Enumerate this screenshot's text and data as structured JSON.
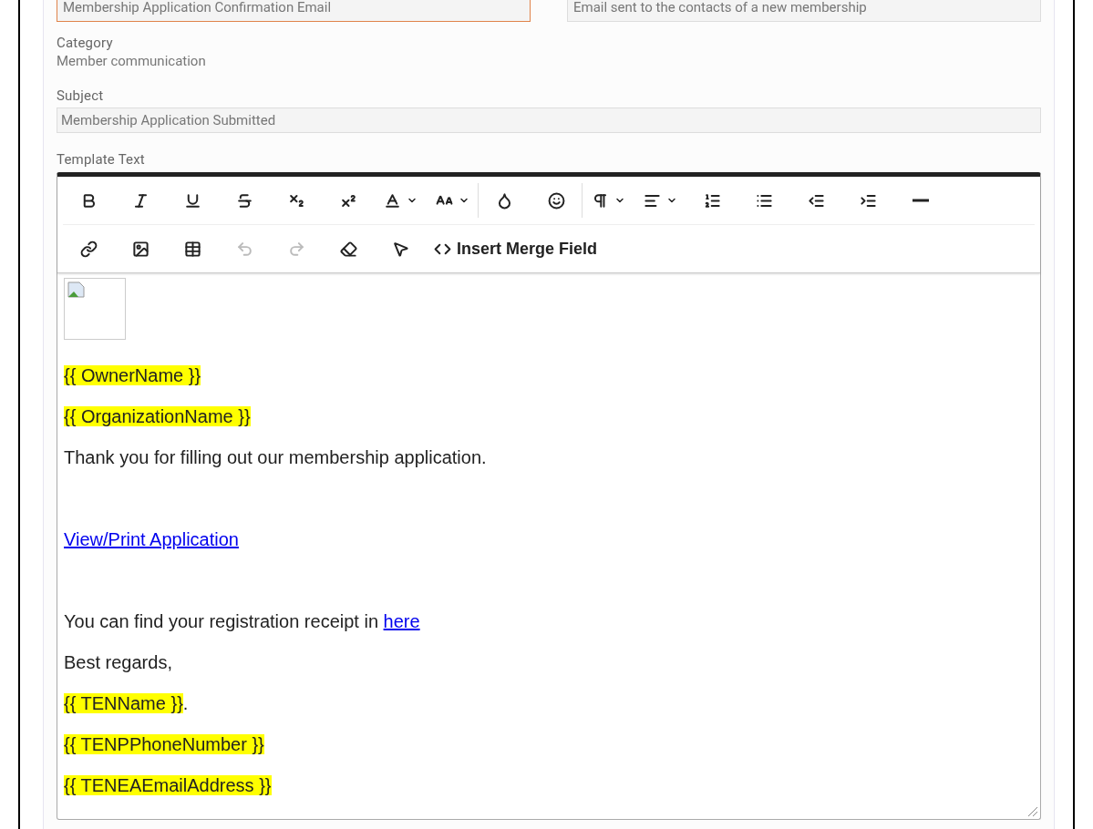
{
  "top_fields": [
    {
      "value": "Membership Application Confirmation Email",
      "focused": true
    },
    {
      "value": "Email sent to the contacts of a new membership",
      "focused": false
    }
  ],
  "category": {
    "label": "Category",
    "value": "Member communication"
  },
  "subject": {
    "label": "Subject",
    "value": "Membership Application Submitted"
  },
  "template": {
    "label": "Template Text",
    "toolbar_rows": [
      [
        {
          "disabled": false
        },
        {
          "disabled": false
        },
        {
          "disabled": false
        },
        {
          "disabled": false
        },
        {
          "disabled": false
        },
        {
          "disabled": false
        },
        {
          "disabled": false
        },
        {
          "disabled": false
        },
        {
          "disabled": false
        },
        {
          "disabled": false
        },
        {
          "disabled": false
        },
        {
          "disabled": false
        },
        {
          "disabled": false
        },
        {
          "disabled": false
        },
        {
          "disabled": false
        },
        {
          "disabled": false
        },
        {
          "disabled": false
        }
      ],
      [
        {
          "disabled": false
        },
        {
          "disabled": false
        },
        {
          "disabled": false
        },
        {
          "disabled": true
        },
        {
          "disabled": true
        },
        {
          "disabled": false
        },
        {
          "disabled": false
        },
        {
          "disabled": false,
          "label": "Insert Merge Field"
        }
      ]
    ],
    "content": [
      {
        "kind": "image"
      },
      {
        "kind": "paragraph",
        "segments": [
          {
            "kind": "merge",
            "text": "{{ OwnerName }}"
          }
        ]
      },
      {
        "kind": "paragraph",
        "segments": [
          {
            "kind": "merge",
            "text": "{{ OrganizationName }}"
          }
        ]
      },
      {
        "kind": "paragraph",
        "segments": [
          {
            "kind": "text",
            "text": "Thank you for filling out our membership application."
          }
        ]
      },
      {
        "kind": "blank"
      },
      {
        "kind": "paragraph",
        "segments": [
          {
            "kind": "link",
            "text": "View/Print Application"
          }
        ]
      },
      {
        "kind": "blank"
      },
      {
        "kind": "paragraph",
        "segments": [
          {
            "kind": "text",
            "text": "You can find your registration receipt in "
          },
          {
            "kind": "link",
            "text": "here"
          }
        ]
      },
      {
        "kind": "paragraph",
        "segments": [
          {
            "kind": "text",
            "text": "Best regards,"
          }
        ]
      },
      {
        "kind": "paragraph",
        "segments": [
          {
            "kind": "merge",
            "text": "{{ TENName }}"
          },
          {
            "kind": "text",
            "text": "."
          }
        ]
      },
      {
        "kind": "paragraph",
        "segments": [
          {
            "kind": "merge",
            "text": "{{ TENPPhoneNumber }}"
          }
        ]
      },
      {
        "kind": "paragraph",
        "segments": [
          {
            "kind": "merge",
            "text": "{{ TENEAEmailAddress }}"
          }
        ]
      }
    ]
  }
}
